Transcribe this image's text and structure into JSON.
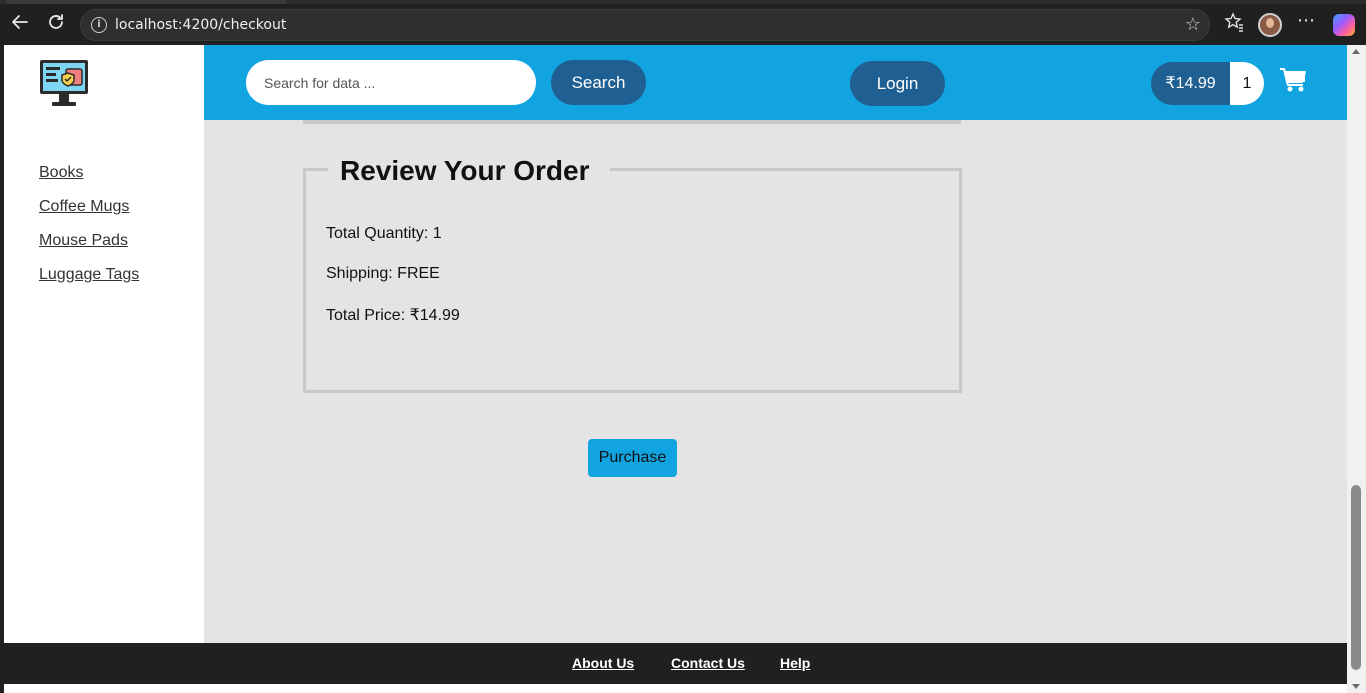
{
  "browser": {
    "url": "localhost:4200/checkout",
    "icons": [
      "back-icon",
      "reload-icon",
      "site-info-icon",
      "favorite-star-icon",
      "favorites-icon",
      "profile-avatar",
      "more-icon",
      "copilot-icon"
    ]
  },
  "header": {
    "search_placeholder": "Search for data ...",
    "search_label": "Search",
    "login_label": "Login",
    "cart_price": "₹14.99",
    "cart_count": "1",
    "cart_icon": "shopping-cart-icon",
    "brand_color": "#11a4e0",
    "button_color": "#1f5f91"
  },
  "sidebar": {
    "items": [
      {
        "label": "Books"
      },
      {
        "label": "Coffee Mugs"
      },
      {
        "label": "Mouse Pads"
      },
      {
        "label": "Luggage Tags"
      }
    ]
  },
  "order": {
    "title": "Review Your Order",
    "quantity": "Total Quantity: 1",
    "shipping": "Shipping: FREE",
    "total": "Total Price: ₹14.99"
  },
  "purchase_label": "Purchase",
  "footer": {
    "links": [
      {
        "label": "About Us"
      },
      {
        "label": "Contact Us"
      },
      {
        "label": "Help"
      }
    ]
  }
}
